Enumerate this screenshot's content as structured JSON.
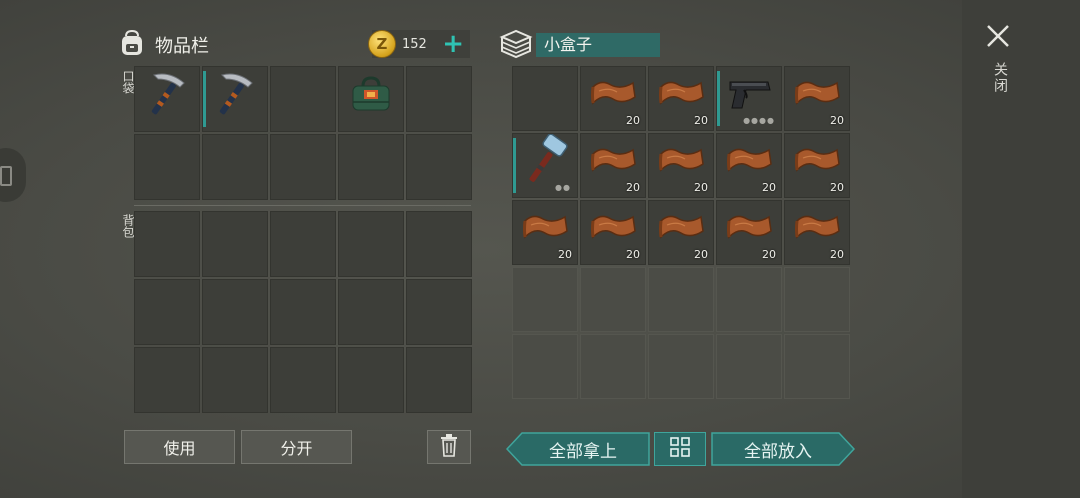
{
  "inventory": {
    "title": "物品栏",
    "pocket_label": "口袋",
    "backpack_label": "背包"
  },
  "currency": {
    "amount": "152",
    "coin_symbol": "Z",
    "add_symbol": "+"
  },
  "container": {
    "title": "小盒子"
  },
  "buttons": {
    "use": "使用",
    "split": "分开",
    "take_all": "全部拿上",
    "put_all": "全部放入"
  },
  "close": {
    "label": "关闭"
  },
  "pocket_items": [
    {
      "slot": 0,
      "icon": "pickaxe-icon"
    },
    {
      "slot": 1,
      "icon": "pickaxe-icon",
      "marked": true
    },
    {
      "slot": 3,
      "icon": "green-bag-icon"
    }
  ],
  "container_items": [
    {
      "slot": 1,
      "icon": "leather-icon",
      "qty": "20"
    },
    {
      "slot": 2,
      "icon": "leather-icon",
      "qty": "20"
    },
    {
      "slot": 3,
      "icon": "pistol-icon",
      "marked": true
    },
    {
      "slot": 4,
      "icon": "leather-icon",
      "qty": "20"
    },
    {
      "slot": 5,
      "icon": "hammer-icon",
      "marked": true
    },
    {
      "slot": 6,
      "icon": "leather-icon",
      "qty": "20"
    },
    {
      "slot": 7,
      "icon": "leather-icon",
      "qty": "20"
    },
    {
      "slot": 8,
      "icon": "leather-icon",
      "qty": "20"
    },
    {
      "slot": 9,
      "icon": "leather-icon",
      "qty": "20"
    },
    {
      "slot": 10,
      "icon": "leather-icon",
      "qty": "20"
    },
    {
      "slot": 11,
      "icon": "leather-icon",
      "qty": "20"
    },
    {
      "slot": 12,
      "icon": "leather-icon",
      "qty": "20"
    },
    {
      "slot": 13,
      "icon": "leather-icon",
      "qty": "20"
    },
    {
      "slot": 14,
      "icon": "leather-icon",
      "qty": "20"
    }
  ],
  "colors": {
    "accent": "#2f6a66",
    "accent_bright": "#2fc3b3",
    "background": "#4a4b45"
  }
}
